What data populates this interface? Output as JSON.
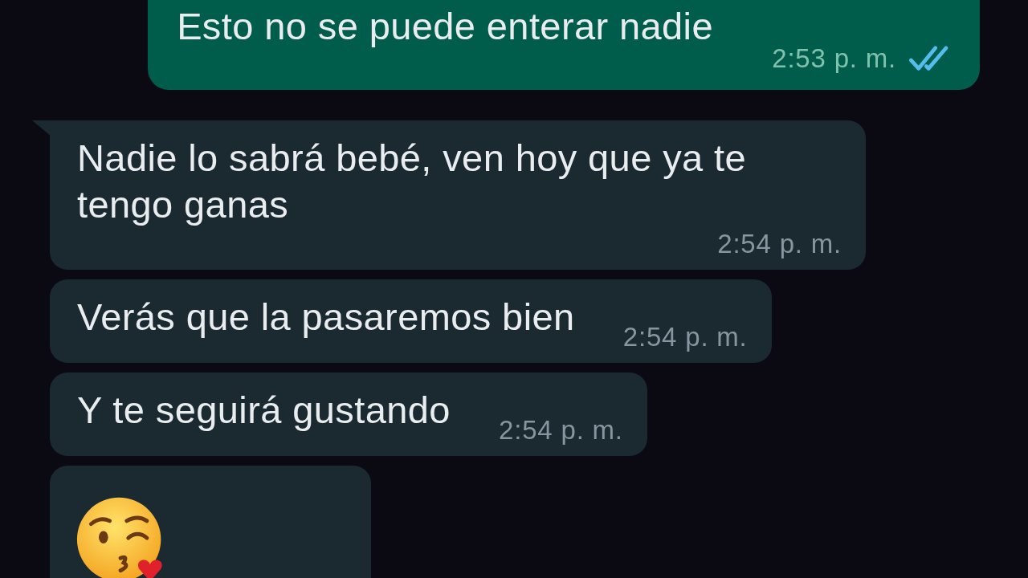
{
  "messages": [
    {
      "kind": "text",
      "outgoing": true,
      "text": "Esto no se puede enterar nadie",
      "time": "2:53 p. m.",
      "read": true
    },
    {
      "kind": "text",
      "outgoing": false,
      "tail": true,
      "text": "Nadie lo sabrá bebé, ven hoy que ya te tengo ganas",
      "time": "2:54 p. m."
    },
    {
      "kind": "text",
      "outgoing": false,
      "tail": false,
      "text": "Verás que la pasaremos bien",
      "time": "2:54 p. m."
    },
    {
      "kind": "text",
      "outgoing": false,
      "tail": false,
      "text": "Y te seguirá gustando",
      "time": "2:54 p. m."
    },
    {
      "kind": "emoji",
      "outgoing": false,
      "tail": false
    }
  ]
}
